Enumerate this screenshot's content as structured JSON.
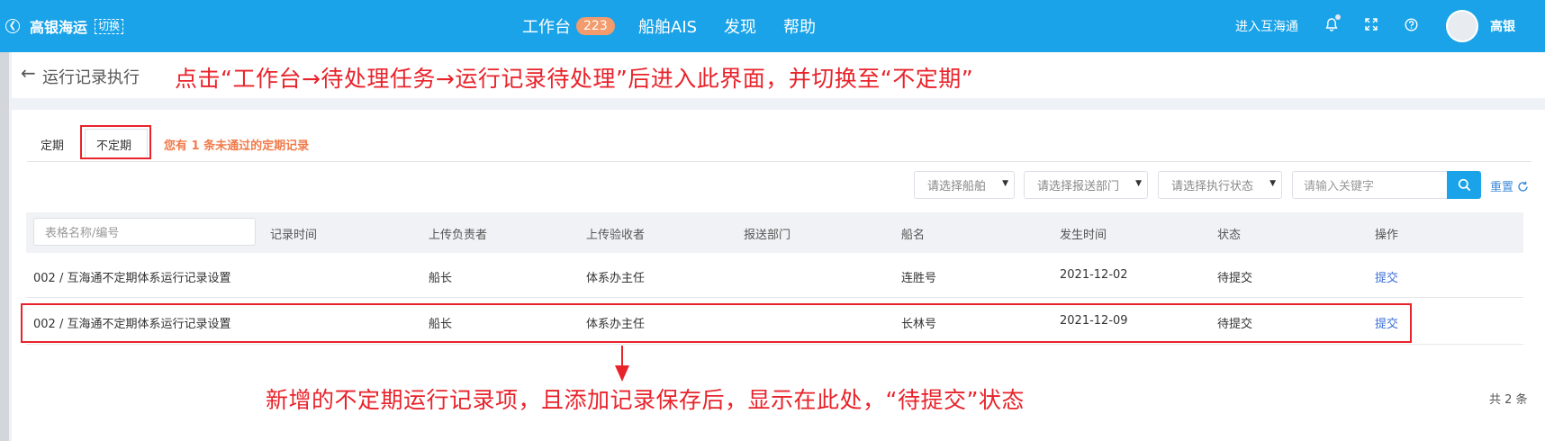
{
  "header": {
    "brand": "高银海运",
    "switch_label": "切换",
    "nav": [
      {
        "label": "工作台",
        "badge": "223"
      },
      {
        "label": "船舶AIS"
      },
      {
        "label": "发现"
      },
      {
        "label": "帮助"
      }
    ],
    "enter_link": "进入互海通",
    "user_name": "高银",
    "icons": [
      "back-circle-icon",
      "bell-icon",
      "fullscreen-icon",
      "help-icon"
    ]
  },
  "breadcrumb": {
    "title": "运行记录执行"
  },
  "annotations": {
    "top": "点击“工作台→待处理任务→运行记录待处理”后进入此界面，并切换至“不定期”",
    "bottom": "新增的不定期运行记录项，且添加记录保存后，显示在此处，“待提交”状态"
  },
  "tabs": [
    {
      "label": "定期",
      "active": false
    },
    {
      "label": "不定期",
      "active": true
    }
  ],
  "warning": "您有 1 条未通过的定期记录",
  "filters": {
    "ship": "请选择船舶",
    "department": "请选择报送部门",
    "status": "请选择执行状态",
    "keyword_placeholder": "请输入关键字",
    "reset": "重置"
  },
  "table": {
    "name_filter_placeholder": "表格名称/编号",
    "headers": [
      "记录时间",
      "上传负责者",
      "上传验收者",
      "报送部门",
      "船名",
      "发生时间",
      "状态",
      "操作"
    ],
    "rows": [
      {
        "name": "002 / 互海通不定期体系运行记录设置",
        "record_time": "",
        "uploader": "船长",
        "acceptor": "体系办主任",
        "department": "",
        "ship": "连胜号",
        "date": "2021-12-02",
        "status": "待提交",
        "action": "提交"
      },
      {
        "name": "002 / 互海通不定期体系运行记录设置",
        "record_time": "",
        "uploader": "船长",
        "acceptor": "体系办主任",
        "department": "",
        "ship": "长林号",
        "date": "2021-12-09",
        "status": "待提交",
        "action": "提交"
      }
    ],
    "total": "共 2 条"
  },
  "colors": {
    "primary": "#1aa3e8",
    "annotation_red": "#e8232b",
    "warning_orange": "#f07b4a",
    "badge": "#f39b6d",
    "link": "#3c6fd8"
  }
}
